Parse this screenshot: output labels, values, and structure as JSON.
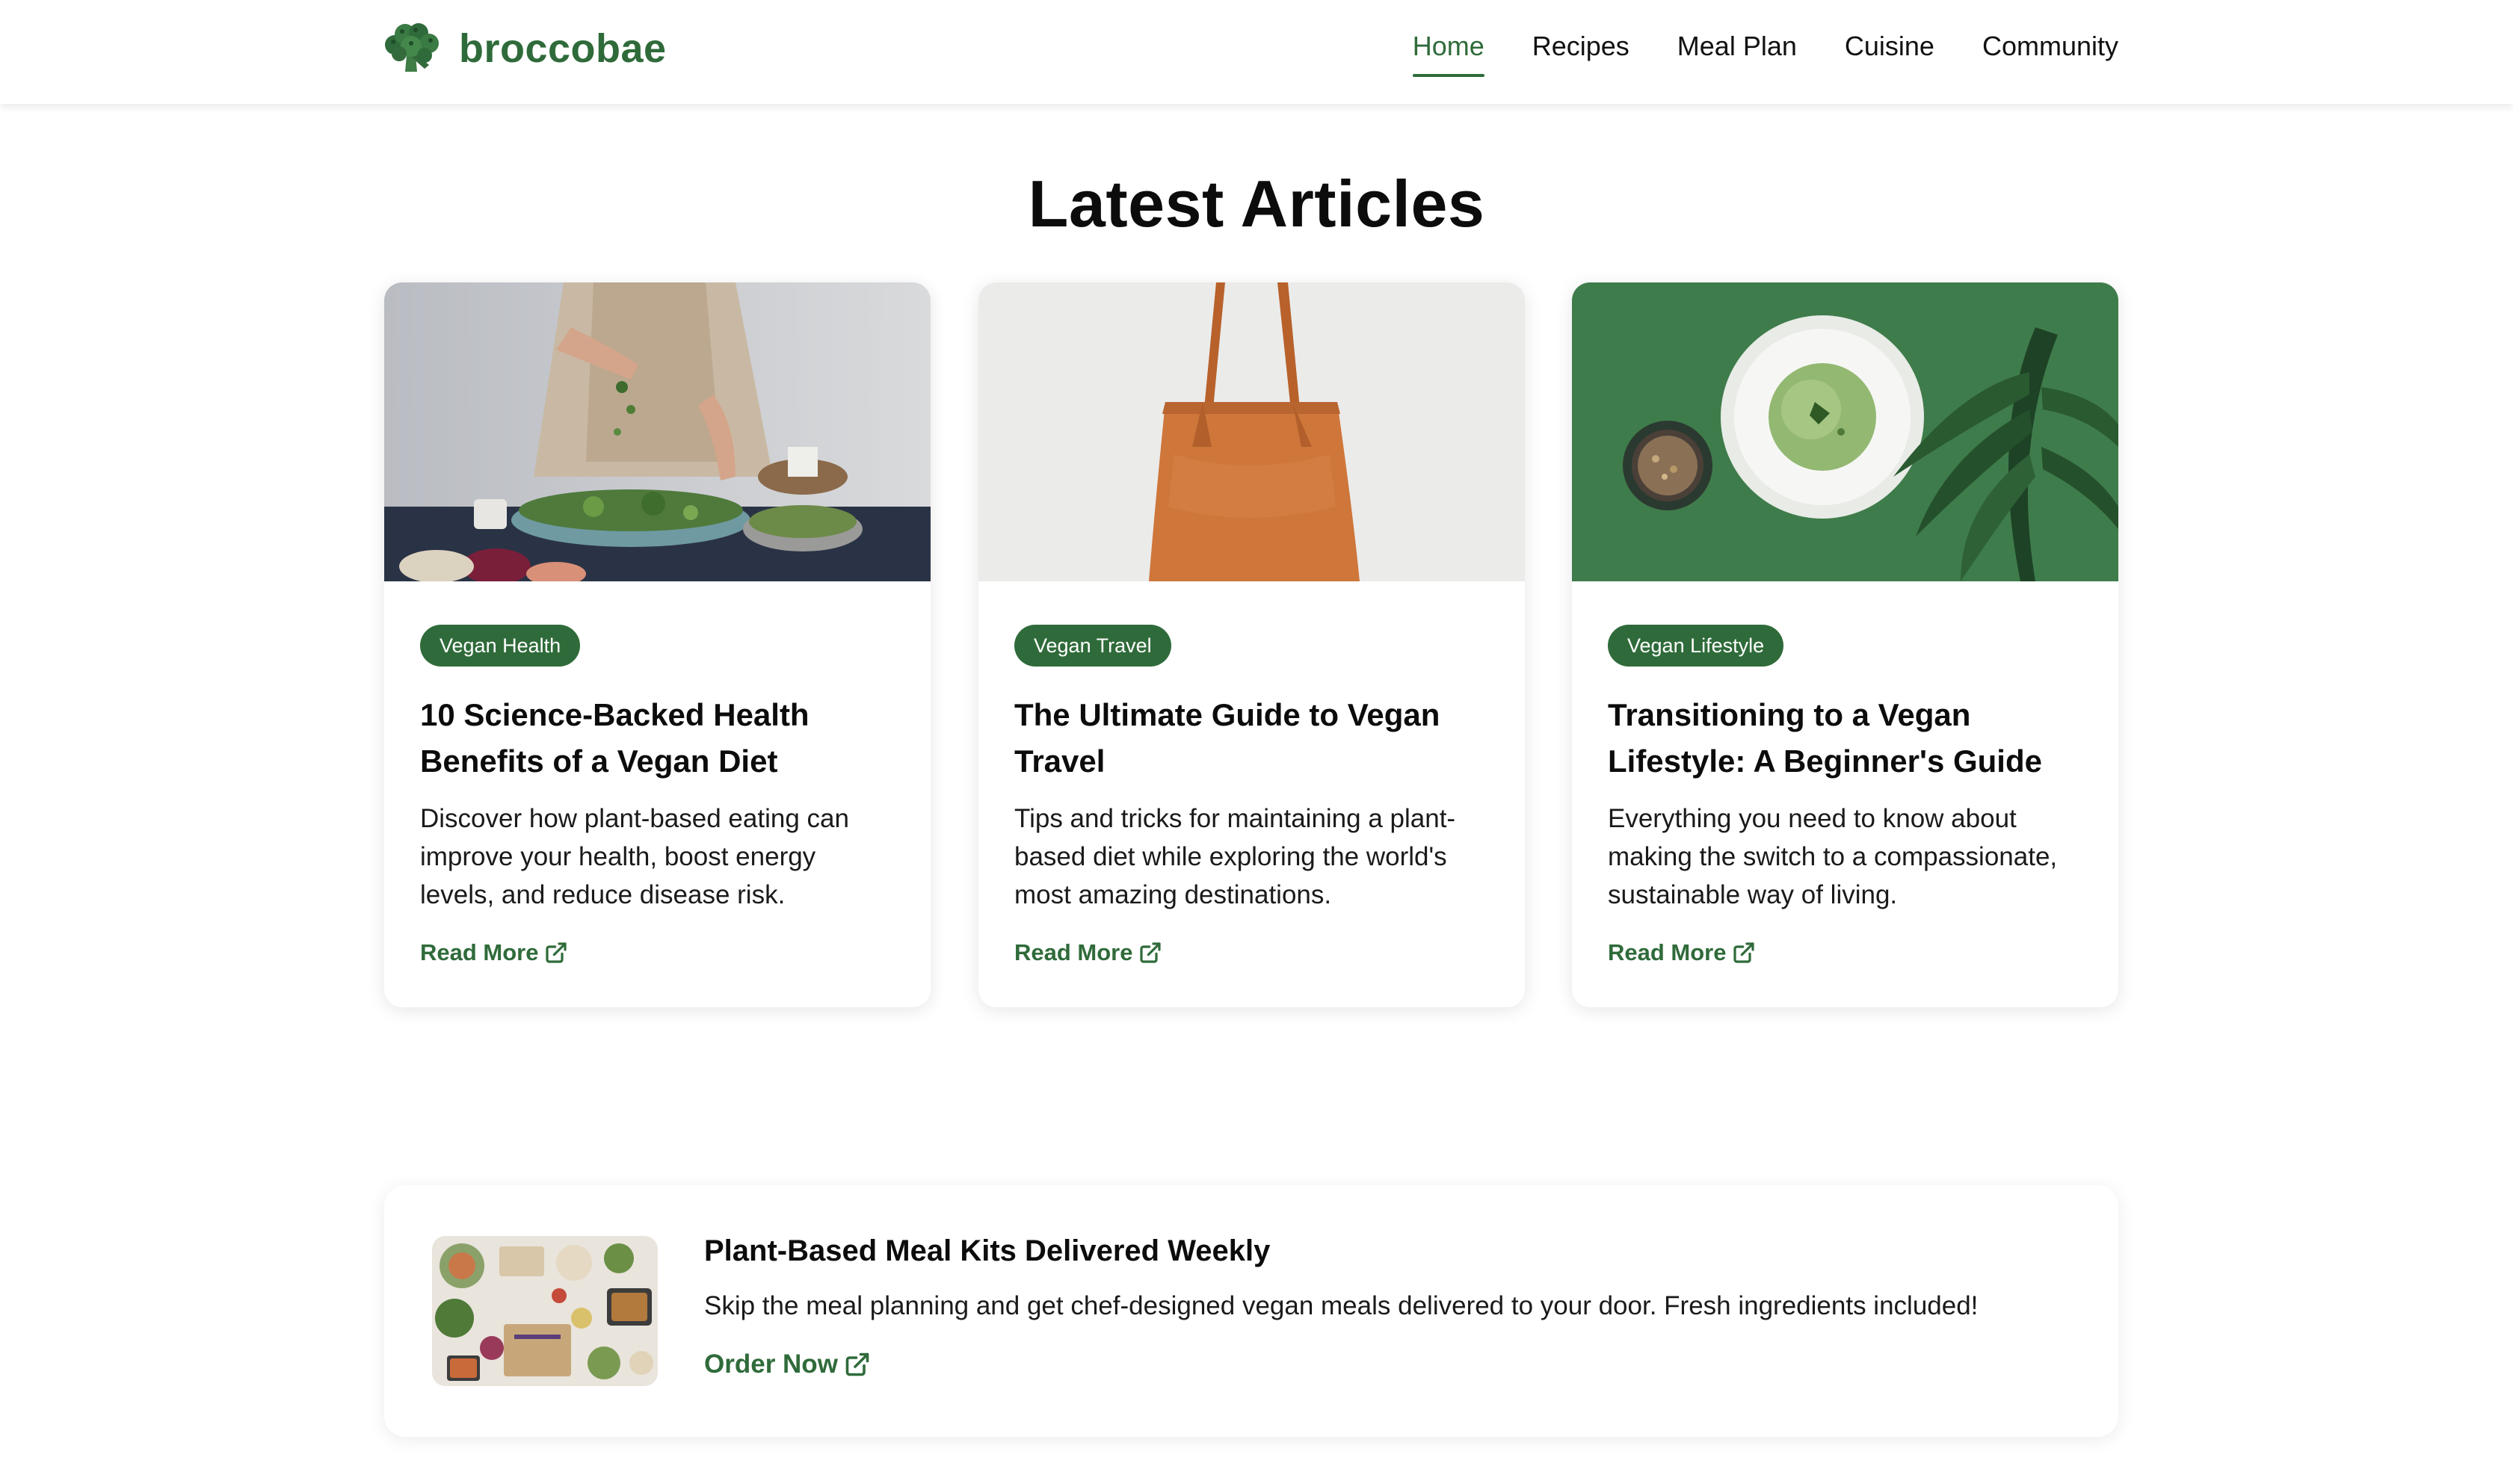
{
  "brand": {
    "name": "broccobae",
    "logo_icon": "broccoli-icon"
  },
  "nav": {
    "items": [
      {
        "label": "Home",
        "active": true
      },
      {
        "label": "Recipes",
        "active": false
      },
      {
        "label": "Meal Plan",
        "active": false
      },
      {
        "label": "Cuisine",
        "active": false
      },
      {
        "label": "Community",
        "active": false
      }
    ]
  },
  "section": {
    "title": "Latest Articles"
  },
  "articles": [
    {
      "tag": "Vegan Health",
      "title": "10 Science-Backed Health Benefits of a Vegan Diet",
      "description": "Discover how plant-based eating can improve your health, boost energy levels, and reduce disease risk.",
      "cta": "Read More"
    },
    {
      "tag": "Vegan Travel",
      "title": "The Ultimate Guide to Vegan Travel",
      "description": "Tips and tricks for maintaining a plant-based diet while exploring the world's most amazing destinations.",
      "cta": "Read More"
    },
    {
      "tag": "Vegan Lifestyle",
      "title": "Transitioning to a Vegan Lifestyle: A Beginner's Guide",
      "description": "Everything you need to know about making the switch to a compassionate, sustainable way of living.",
      "cta": "Read More"
    }
  ],
  "promo": {
    "title": "Plant-Based Meal Kits Delivered Weekly",
    "text": "Skip the meal planning and get chef-designed vegan meals delivered to your door. Fresh ingredients included!",
    "cta": "Order Now"
  },
  "colors": {
    "brand_green": "#2f6b3a",
    "text": "#111111",
    "background": "#ffffff"
  },
  "icons": {
    "external_link": "external-link-icon"
  }
}
